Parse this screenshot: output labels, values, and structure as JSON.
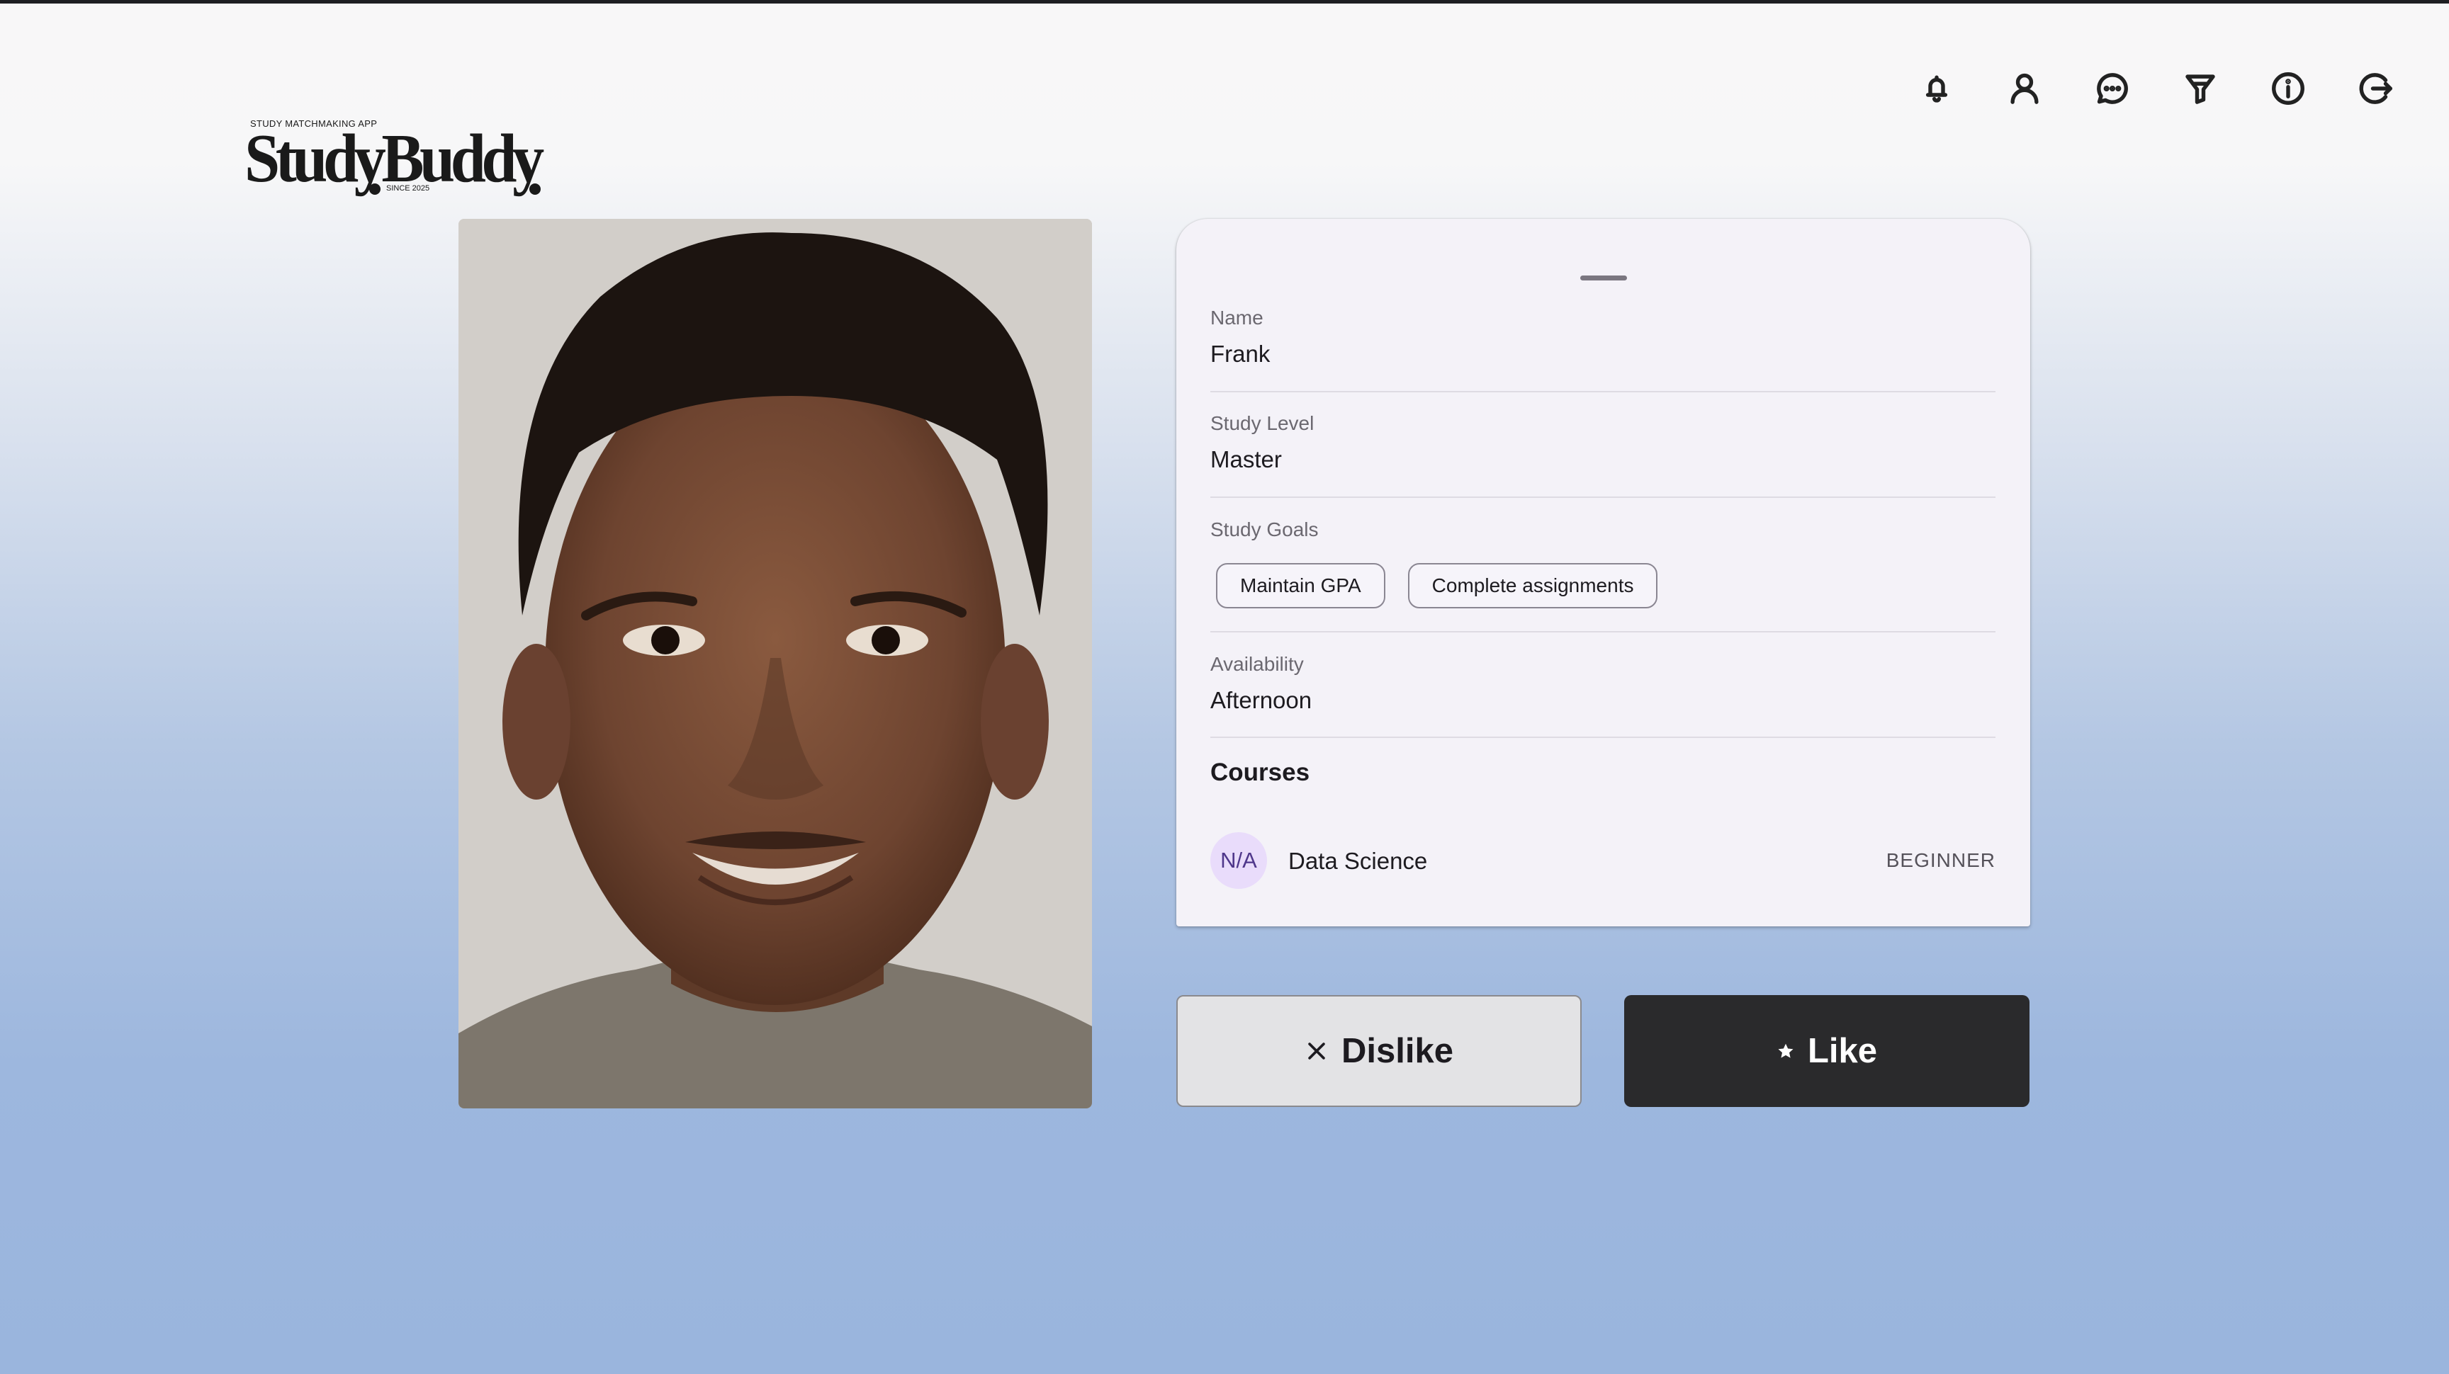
{
  "app": {
    "logo_tagline": "STUDY MATCHMAKING APP",
    "logo_wordmark": "StudyBuddy",
    "logo_since": "SINCE 2025"
  },
  "nav": {
    "icons": [
      "bell-icon",
      "profile-icon",
      "chat-icon",
      "filter-icon",
      "info-icon",
      "logout-icon"
    ]
  },
  "profile": {
    "photo_alt": "Profile photo",
    "name_label": "Name",
    "name": "Frank",
    "study_level_label": "Study Level",
    "study_level": "Master",
    "study_goals_label": "Study Goals",
    "study_goals": [
      "Maintain GPA",
      "Complete assignments"
    ],
    "availability_label": "Availability",
    "availability": "Afternoon",
    "courses_title": "Courses",
    "courses": [
      {
        "avatar": "N/A",
        "name": "Data Science",
        "level": "BEGINNER"
      }
    ]
  },
  "actions": {
    "dislike_label": "Dislike",
    "like_label": "Like"
  },
  "colors": {
    "like_bg": "#2a2a2c",
    "dislike_bg": "#e3e3e5",
    "course_avatar_bg": "#e9dcfb",
    "course_avatar_text": "#4f378b"
  }
}
